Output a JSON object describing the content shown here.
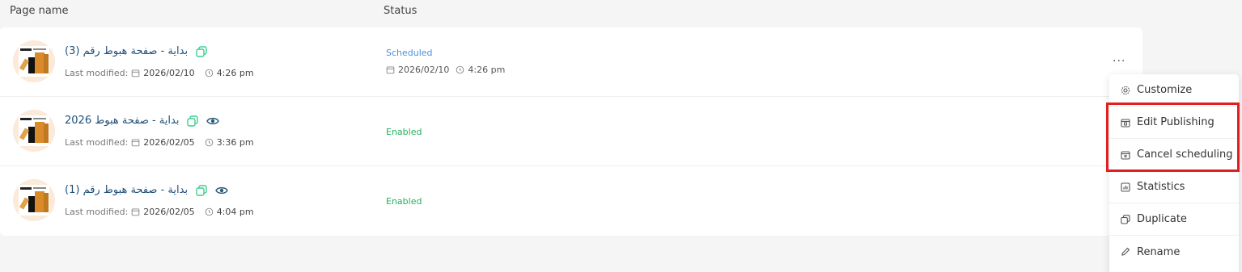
{
  "table": {
    "headers": {
      "page_name": "Page name",
      "status": "Status"
    },
    "rows": [
      {
        "title": "بداية - صفحة هبوط رقم (3)",
        "modified_label": "Last modified:",
        "date": "2026/02/10",
        "time": "4:26 pm",
        "status": "Scheduled",
        "status_date": "2026/02/10",
        "status_time": "4:26 pm",
        "has_view_icon": false
      },
      {
        "title": "بداية - صفحة هبوط 2026",
        "modified_label": "Last modified:",
        "date": "2026/02/05",
        "time": "3:36 pm",
        "status": "Enabled",
        "has_view_icon": true
      },
      {
        "title": "بداية - صفحة هبوط رقم (1)",
        "modified_label": "Last modified:",
        "date": "2026/02/05",
        "time": "4:04 pm",
        "status": "Enabled",
        "has_view_icon": true
      }
    ]
  },
  "context_menu": {
    "items": [
      {
        "label": "Customize",
        "icon": "gear-icon"
      },
      {
        "label": "Edit Publishing",
        "icon": "calendar-edit-icon"
      },
      {
        "label": "Cancel scheduling",
        "icon": "calendar-cancel-icon"
      },
      {
        "label": "Statistics",
        "icon": "chart-icon"
      },
      {
        "label": "Duplicate",
        "icon": "copy-icon"
      },
      {
        "label": "Rename",
        "icon": "pencil-icon"
      }
    ]
  },
  "colors": {
    "title": "#1f4f7a",
    "scheduled": "#4a90e2",
    "enabled": "#27ae60",
    "copy_icon": "#3ccf8e",
    "highlight": "#e02020"
  }
}
